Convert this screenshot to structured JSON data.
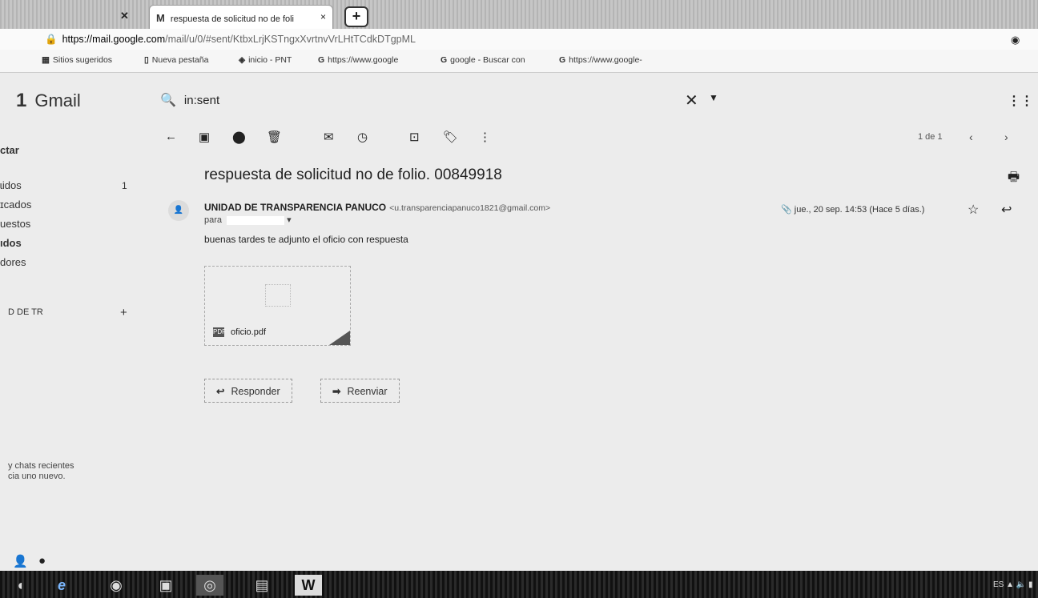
{
  "browser": {
    "tab_title": "respuesta de solicitud no de foli",
    "tab_close": "×",
    "tab_icon": "M",
    "url_host": "https://mail.google.com",
    "url_path": "/mail/u/0/#sent/KtbxLrjKSTngxXvrtnvVrLHtTCdkDTgpML",
    "bookmarks": [
      "Sitios sugeridos",
      "Nueva pestaña",
      "inicio - PNT",
      "https://www.google",
      "google - Buscar con",
      "https://www.google-"
    ]
  },
  "gmail": {
    "logo_text": "Gmail",
    "search_value": "in:sent",
    "sidebar": {
      "compose": "ctar",
      "items": [
        {
          "label": "ɩidos",
          "count": "1"
        },
        {
          "label": "ɪcados",
          "count": ""
        },
        {
          "label": "uestos",
          "count": ""
        },
        {
          "label": "ıdos",
          "count": ""
        },
        {
          "label": "dores",
          "count": ""
        }
      ],
      "hangouts_user": "D DE TR",
      "hangouts_add": "+",
      "recent_line1": "y chats recientes",
      "recent_line2": "cia uno nuevo."
    },
    "pager": "1 de 1",
    "message": {
      "subject": "respuesta de solicitud no de folio. 00849918",
      "sender_name": "UNIDAD DE TRANSPARENCIA PANUCO",
      "sender_email": "<u.transparenciapanuco1821@gmail.com>",
      "to_prefix": "para",
      "date": "jue., 20 sep. 14:53 (Hace 5 días.)",
      "body": "buenas tardes te adjunto el oficio con respuesta",
      "attachment_name": "oficio.pdf"
    },
    "actions": {
      "reply": "Responder",
      "forward": "Reenviar"
    }
  },
  "tray": {
    "lang": "ES"
  },
  "icons": [
    "back-arrow-icon",
    "archive-icon",
    "report-spam-icon",
    "delete-icon",
    "mark-unread-icon",
    "snooze-icon",
    "move-to-icon",
    "labels-icon",
    "more-icon",
    "print-icon",
    "star-icon",
    "reply-icon",
    "search-icon",
    "apps-grid-icon"
  ]
}
